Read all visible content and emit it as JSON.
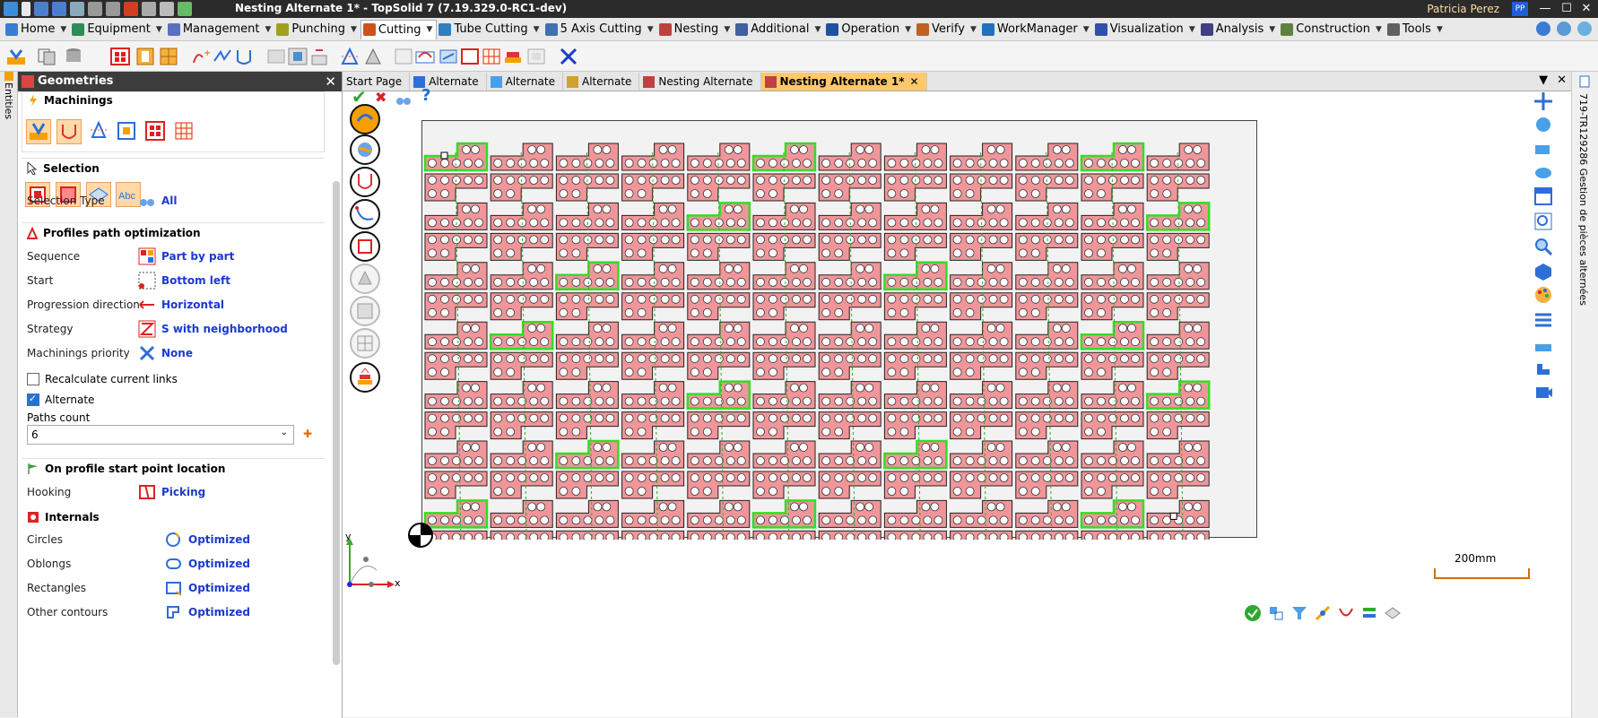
{
  "window": {
    "title": "Nesting Alternate 1* - TopSolid 7 (7.19.329.0-RC1-dev)",
    "user": "Patricia Perez",
    "user_initials": "PP",
    "minimize": "—",
    "maximize": "☐",
    "close": "✕"
  },
  "menu": {
    "tabs": [
      {
        "label": "Home",
        "icon": "home-icon",
        "color": "#3a7bd5"
      },
      {
        "label": "Equipment",
        "icon": "equipment-icon",
        "color": "#2e8b57"
      },
      {
        "label": "Management",
        "icon": "management-icon",
        "color": "#5a6fbf"
      },
      {
        "label": "Punching",
        "icon": "punching-icon",
        "color": "#a0a020"
      },
      {
        "label": "Cutting",
        "icon": "cutting-icon",
        "color": "#d05020"
      },
      {
        "label": "Tube Cutting",
        "icon": "tube-icon",
        "color": "#3080c0"
      },
      {
        "label": "5 Axis Cutting",
        "icon": "5axis-icon",
        "color": "#4070b0"
      },
      {
        "label": "Nesting",
        "icon": "nesting-icon",
        "color": "#c04040"
      },
      {
        "label": "Additional",
        "icon": "additional-icon",
        "color": "#4060a0"
      },
      {
        "label": "Operation",
        "icon": "operation-icon",
        "color": "#2050a0"
      },
      {
        "label": "Verify",
        "icon": "verify-icon",
        "color": "#c06020"
      },
      {
        "label": "WorkManager",
        "icon": "workmanager-icon",
        "color": "#2070c0"
      },
      {
        "label": "Visualization",
        "icon": "visualization-icon",
        "color": "#3050b0"
      },
      {
        "label": "Analysis",
        "icon": "analysis-icon",
        "color": "#404080"
      },
      {
        "label": "Construction",
        "icon": "construction-icon",
        "color": "#608040"
      },
      {
        "label": "Tools",
        "icon": "tools-icon",
        "color": "#606060"
      }
    ],
    "active_index": 4
  },
  "panel": {
    "title": "Geometries",
    "close": "✕",
    "side_tab": "Entities",
    "machinings": {
      "title": "Machinings"
    },
    "selection": {
      "title": "Selection",
      "type_label": "Selection Type",
      "type_value": "All"
    },
    "path_opt": {
      "title": "Profiles path optimization",
      "sequence_label": "Sequence",
      "sequence_value": "Part by part",
      "start_label": "Start",
      "start_value": "Bottom left",
      "progression_label": "Progression direction",
      "progression_value": "Horizontal",
      "strategy_label": "Strategy",
      "strategy_value": "S with neighborhood",
      "priority_label": "Machinings priority",
      "priority_value": "None",
      "recalc_label": "Recalculate current links",
      "recalc_checked": false,
      "alternate_label": "Alternate",
      "alternate_checked": true,
      "paths_count_label": "Paths count",
      "paths_count_value": "6",
      "add": "✚"
    },
    "start_point": {
      "title": "On profile start point location",
      "hooking_label": "Hooking",
      "hooking_value": "Picking"
    },
    "internals": {
      "title": "Internals",
      "circles_label": "Circles",
      "circles_value": "Optimized",
      "oblongs_label": "Oblongs",
      "oblongs_value": "Optimized",
      "rectangles_label": "Rectangles",
      "rectangles_value": "Optimized",
      "other_label": "Other contours",
      "other_value": "Optimized"
    }
  },
  "doc_tabs": [
    {
      "label": "Start Page",
      "active": false
    },
    {
      "label": "Alternate",
      "active": false
    },
    {
      "label": "Alternate",
      "active": false
    },
    {
      "label": "Alternate",
      "active": false
    },
    {
      "label": "Nesting Alternate",
      "active": false
    },
    {
      "label": "Nesting Alternate 1*",
      "active": true
    }
  ],
  "doc_tab_close": "✕",
  "doc_controls": {
    "menu": "▼",
    "close": "✕"
  },
  "viewport": {
    "top_actions": {
      "ok": "✔",
      "cancel": "✖",
      "help": "?"
    },
    "axis_x": "x",
    "axis_y": "y",
    "scale_label": "200mm",
    "sheet": {
      "rows": 7,
      "cols": 12
    },
    "colors": {
      "part_fill": "#f0969a",
      "part_stroke": "#222222",
      "highlight": "#33dd22",
      "path": "#33aa22",
      "sheet_bg": "#f2f2f2"
    }
  },
  "right_strip": {
    "label": "719-TR129286 Gestion de pièces alternées"
  }
}
